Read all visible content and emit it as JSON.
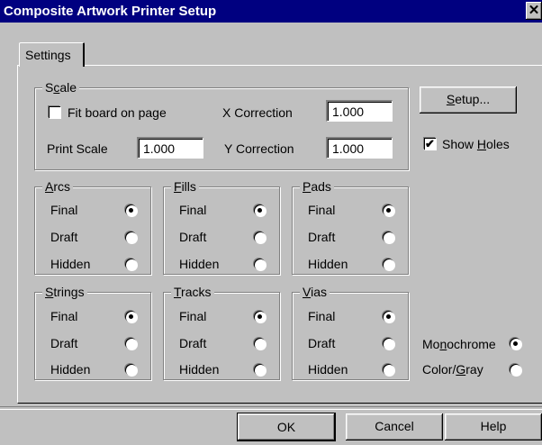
{
  "window": {
    "title": "Composite Artwork Printer Setup",
    "close_glyph": "✕"
  },
  "tabs": [
    {
      "label": "Settings"
    }
  ],
  "scale": {
    "legend_pre": "S",
    "legend_mnemonic": "c",
    "legend_post": "ale",
    "fit_board_label": "Fit board on page",
    "fit_board_checked": false,
    "x_correction_label": "X Correction",
    "x_correction_value": "1.000",
    "print_scale_label": "Print Scale",
    "print_scale_value": "1.000",
    "y_correction_label": "Y Correction",
    "y_correction_value": "1.000"
  },
  "setup_button": {
    "mnemonic": "S",
    "rest": "etup..."
  },
  "show_holes": {
    "pre": "Show ",
    "mnemonic": "H",
    "post": "oles",
    "checked": true
  },
  "options": [
    "Final",
    "Draft",
    "Hidden"
  ],
  "groups": {
    "arcs": {
      "mnemonic": "A",
      "rest": "rcs",
      "selected": "Final"
    },
    "fills": {
      "mnemonic": "F",
      "rest": "ills",
      "selected": "Final"
    },
    "pads": {
      "mnemonic": "P",
      "rest": "ads",
      "selected": "Final"
    },
    "strings": {
      "mnemonic": "S",
      "rest": "trings",
      "selected": "Final"
    },
    "tracks": {
      "mnemonic": "T",
      "rest": "racks",
      "selected": "Final"
    },
    "vias": {
      "mnemonic": "V",
      "rest": "ias",
      "selected": "Final"
    }
  },
  "color_mode": {
    "monochrome": {
      "pre": "Mo",
      "mnemonic": "n",
      "post": "ochrome",
      "selected": true
    },
    "colorgray": {
      "pre": "Color/",
      "mnemonic": "G",
      "post": "ray",
      "selected": false
    }
  },
  "footer": {
    "ok_label": "OK",
    "cancel_label": "Cancel",
    "help_label": "Help"
  }
}
